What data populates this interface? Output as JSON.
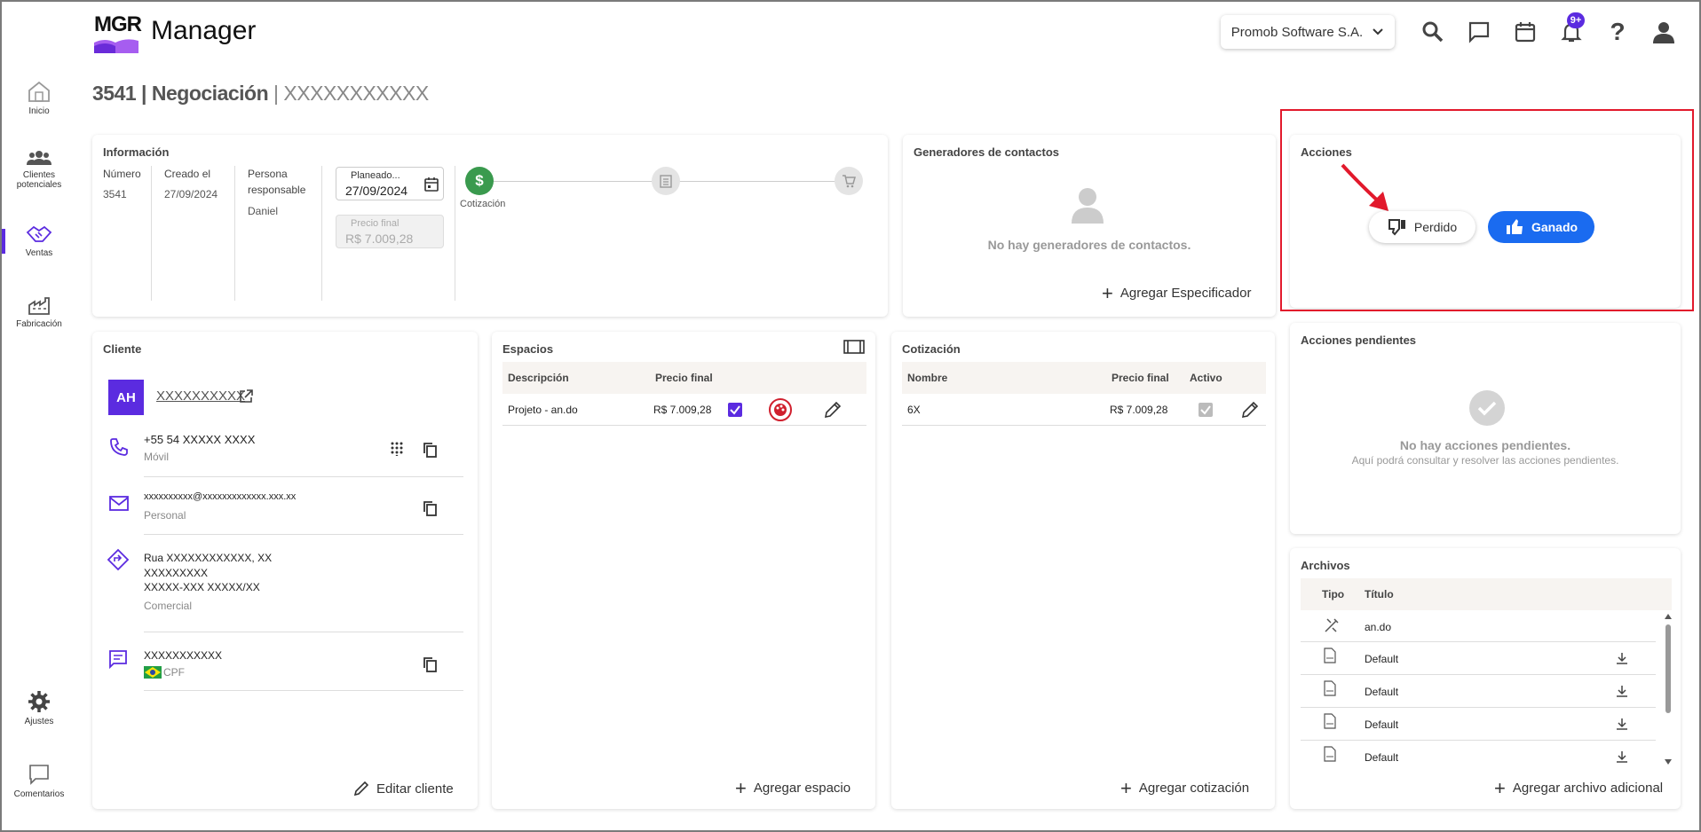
{
  "header": {
    "logo_text": "MGR",
    "app_name": "Manager",
    "company": "Promob Software S.A.",
    "notifications_badge": "9+"
  },
  "sidebar": {
    "items": [
      {
        "label": "Inicio"
      },
      {
        "label": "Clientes potenciales"
      },
      {
        "label": "Ventas"
      },
      {
        "label": "Fabricación"
      },
      {
        "label": "Ajustes"
      },
      {
        "label": "Comentarios"
      }
    ]
  },
  "page": {
    "number": "3541",
    "section": "Negociación",
    "name": "XXXXXXXXXXX"
  },
  "info": {
    "title": "Información",
    "numero_label": "Número",
    "numero": "3541",
    "creado_label": "Creado el",
    "creado": "27/09/2024",
    "persona_label_1": "Persona",
    "persona_label_2": "responsable",
    "persona": "Daniel",
    "planeado_label": "Planeado...",
    "planeado": "27/09/2024",
    "precio_label": "Precio final",
    "precio": "R$ 7.009,28",
    "step_label": "Cotización"
  },
  "generadores": {
    "title": "Generadores de contactos",
    "empty": "No hay generadores de contactos.",
    "add": "Agregar Especificador"
  },
  "acciones": {
    "title": "Acciones",
    "perdido": "Perdido",
    "ganado": "Ganado"
  },
  "pendientes": {
    "title": "Acciones pendientes",
    "empty": "No hay acciones pendientes.",
    "hint": "Aquí podrá consultar y resolver las acciones pendientes."
  },
  "cliente": {
    "title": "Cliente",
    "initials": "AH",
    "name": "XXXXXXXXXX",
    "phone": "+55 54 XXXXX XXXX",
    "phone_type": "Móvil",
    "email": "xxxxxxxxxx@xxxxxxxxxxxxx.xxx.xx",
    "email_type": "Personal",
    "address_1": "Rua XXXXXXXXXXXX, XX",
    "address_2": "XXXXXXXXX",
    "address_3": "XXXXX-XXX  XXXXX/XX",
    "address_type": "Comercial",
    "doc": "XXXXXXXXXXX",
    "doc_type": "CPF",
    "edit": "Editar cliente"
  },
  "espacios": {
    "title": "Espacios",
    "col_desc": "Descripción",
    "col_precio": "Precio final",
    "row_desc": "Projeto - an.do",
    "row_precio": "R$ 7.009,28",
    "add": "Agregar espacio"
  },
  "cotizacion": {
    "title": "Cotización",
    "col_nombre": "Nombre",
    "col_precio": "Precio final",
    "col_activo": "Activo",
    "row_nombre": "6X",
    "row_precio": "R$ 7.009,28",
    "add": "Agregar cotización"
  },
  "archivos": {
    "title": "Archivos",
    "col_tipo": "Tipo",
    "col_titulo": "Título",
    "rows": [
      {
        "title": "an.do"
      },
      {
        "title": "Default"
      },
      {
        "title": "Default"
      },
      {
        "title": "Default"
      },
      {
        "title": "Default"
      }
    ],
    "add": "Agregar archivo adicional"
  },
  "colors": {
    "accent": "#5b2be0",
    "primary_button": "#1a6bf0",
    "highlight": "#e2192c",
    "success": "#3a9a4e"
  }
}
